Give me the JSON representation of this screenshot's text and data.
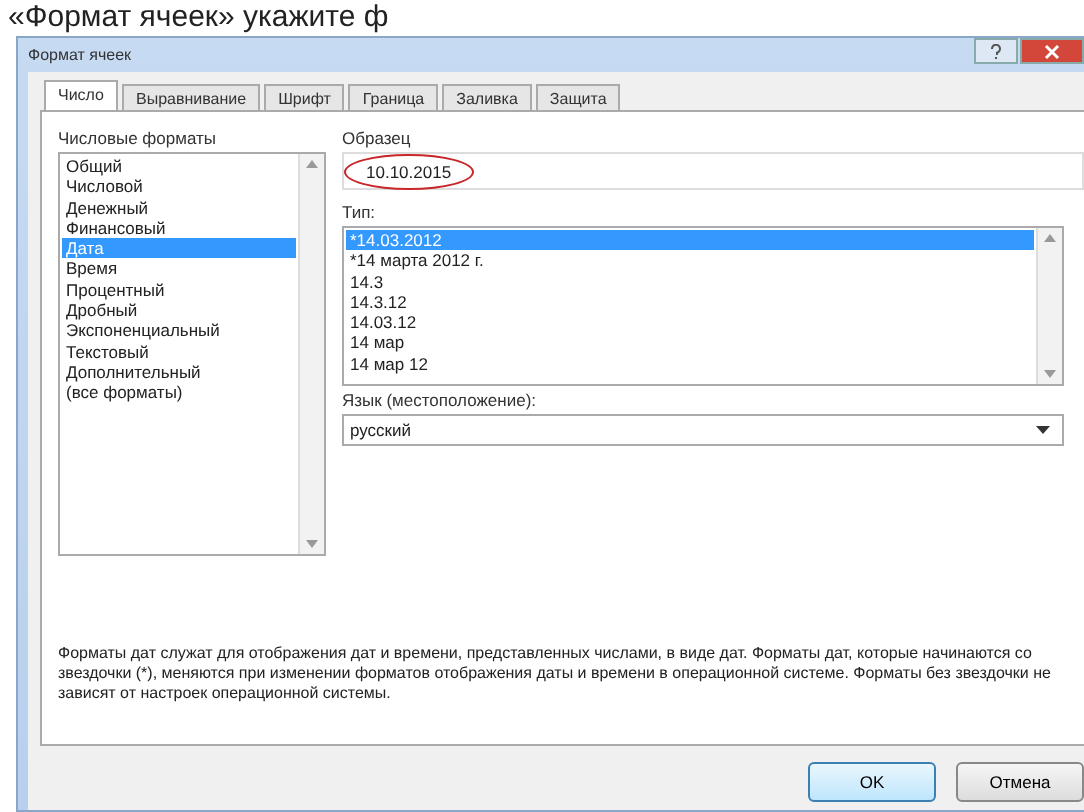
{
  "heading": "«Формат ячеек» укажите ф",
  "window": {
    "title": "Формат ячеек"
  },
  "tabs": [
    {
      "label": "Число",
      "selected": true
    },
    {
      "label": "Выравнивание",
      "selected": false
    },
    {
      "label": "Шрифт",
      "selected": false
    },
    {
      "label": "Граница",
      "selected": false
    },
    {
      "label": "Заливка",
      "selected": false
    },
    {
      "label": "Защита",
      "selected": false
    }
  ],
  "formats": {
    "label": "Числовые форматы",
    "items": [
      {
        "label": "Общий",
        "selected": false
      },
      {
        "label": "Числовой",
        "selected": false
      },
      {
        "label": "Денежный",
        "selected": false
      },
      {
        "label": "Финансовый",
        "selected": false
      },
      {
        "label": "Дата",
        "selected": true
      },
      {
        "label": "Время",
        "selected": false
      },
      {
        "label": "Процентный",
        "selected": false
      },
      {
        "label": "Дробный",
        "selected": false
      },
      {
        "label": "Экспоненциальный",
        "selected": false
      },
      {
        "label": "Текстовый",
        "selected": false
      },
      {
        "label": "Дополнительный",
        "selected": false
      },
      {
        "label": "(все форматы)",
        "selected": false
      }
    ]
  },
  "sample": {
    "label": "Образец",
    "value": "10.10.2015",
    "circled": true
  },
  "type": {
    "label": "Тип:",
    "items": [
      {
        "label": "*14.03.2012",
        "selected": true
      },
      {
        "label": "*14 марта 2012 г.",
        "selected": false
      },
      {
        "label": "14.3",
        "selected": false
      },
      {
        "label": "14.3.12",
        "selected": false
      },
      {
        "label": "14.03.12",
        "selected": false
      },
      {
        "label": "14 мар",
        "selected": false
      },
      {
        "label": "14 мар 12",
        "selected": false
      }
    ]
  },
  "locale": {
    "label": "Язык (местоположение):",
    "value": "русский"
  },
  "description": "Форматы дат служат для отображения дат и времени, представленных числами, в виде дат. Форматы дат, которые начинаются со звездочки (*), меняются при изменении форматов отображения даты и времени в операционной системе. Форматы без звездочки не зависят от настроек операционной системы.",
  "buttons": [
    "OK",
    "Отмена"
  ]
}
